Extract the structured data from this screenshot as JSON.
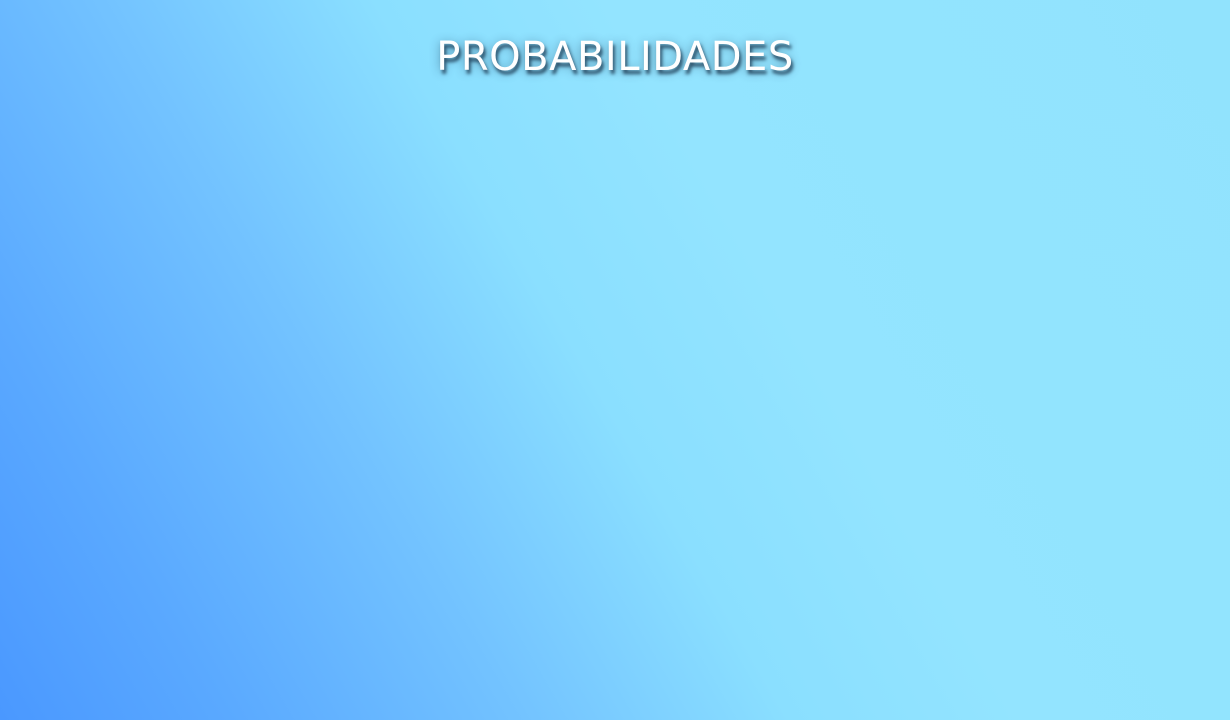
{
  "slide": {
    "title": "PROBABILIDADES"
  },
  "colors": {
    "gradient_dark": "#4a98ff",
    "gradient_light": "#93e4ff",
    "title_text": "#ffffff"
  }
}
